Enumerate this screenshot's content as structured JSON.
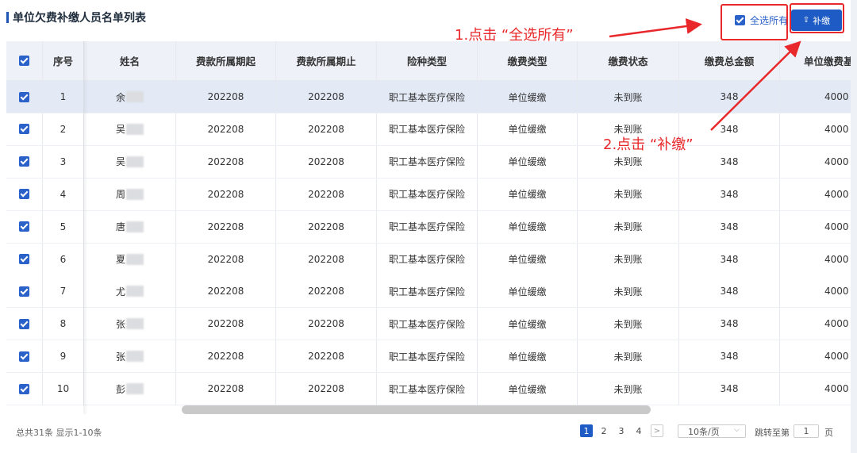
{
  "title": "单位欠费补缴人员名单列表",
  "select_all_label": "全选所有",
  "repay_button": {
    "icon": "upload-icon",
    "label": "补缴"
  },
  "annotations": {
    "step1": "1.点击 “全选所有”",
    "step2": "2.点击 “补缴”"
  },
  "colors": {
    "accent": "#1f5bc4",
    "annotation": "#e8282b",
    "selected_row": "#e3eaf6"
  },
  "columns": [
    "序号",
    "姓名",
    "费款所属期起",
    "费款所属期止",
    "险种类型",
    "缴费类型",
    "缴费状态",
    "缴费总金额",
    "单位缴费基"
  ],
  "rows": [
    {
      "no": "1",
      "name": "余",
      "start": "202208",
      "end": "202208",
      "insurance": "职工基本医疗保险",
      "pay_type": "单位缓缴",
      "status": "未到账",
      "total": "348",
      "base": "4000"
    },
    {
      "no": "2",
      "name": "吴",
      "start": "202208",
      "end": "202208",
      "insurance": "职工基本医疗保险",
      "pay_type": "单位缓缴",
      "status": "未到账",
      "total": "348",
      "base": "4000"
    },
    {
      "no": "3",
      "name": "吴",
      "start": "202208",
      "end": "202208",
      "insurance": "职工基本医疗保险",
      "pay_type": "单位缓缴",
      "status": "未到账",
      "total": "348",
      "base": "4000"
    },
    {
      "no": "4",
      "name": "周",
      "start": "202208",
      "end": "202208",
      "insurance": "职工基本医疗保险",
      "pay_type": "单位缓缴",
      "status": "未到账",
      "total": "348",
      "base": "4000"
    },
    {
      "no": "5",
      "name": "唐",
      "start": "202208",
      "end": "202208",
      "insurance": "职工基本医疗保险",
      "pay_type": "单位缓缴",
      "status": "未到账",
      "total": "348",
      "base": "4000"
    },
    {
      "no": "6",
      "name": "夏",
      "start": "202208",
      "end": "202208",
      "insurance": "职工基本医疗保险",
      "pay_type": "单位缓缴",
      "status": "未到账",
      "total": "348",
      "base": "4000"
    },
    {
      "no": "7",
      "name": "尤",
      "start": "202208",
      "end": "202208",
      "insurance": "职工基本医疗保险",
      "pay_type": "单位缓缴",
      "status": "未到账",
      "total": "348",
      "base": "4000"
    },
    {
      "no": "8",
      "name": "张",
      "start": "202208",
      "end": "202208",
      "insurance": "职工基本医疗保险",
      "pay_type": "单位缓缴",
      "status": "未到账",
      "total": "348",
      "base": "4000"
    },
    {
      "no": "9",
      "name": "张",
      "start": "202208",
      "end": "202208",
      "insurance": "职工基本医疗保险",
      "pay_type": "单位缓缴",
      "status": "未到账",
      "total": "348",
      "base": "4000"
    },
    {
      "no": "10",
      "name": "彭",
      "start": "202208",
      "end": "202208",
      "insurance": "职工基本医疗保险",
      "pay_type": "单位缓缴",
      "status": "未到账",
      "total": "348",
      "base": "4000"
    }
  ],
  "footer": {
    "total_text": "总共31条 显示1-10条",
    "pages": [
      "1",
      "2",
      "3",
      "4"
    ],
    "next_icon": "chevron-right-icon",
    "page_size": "10条/页",
    "jump_label": "跳转至第",
    "jump_value": "1",
    "jump_unit": "页"
  }
}
